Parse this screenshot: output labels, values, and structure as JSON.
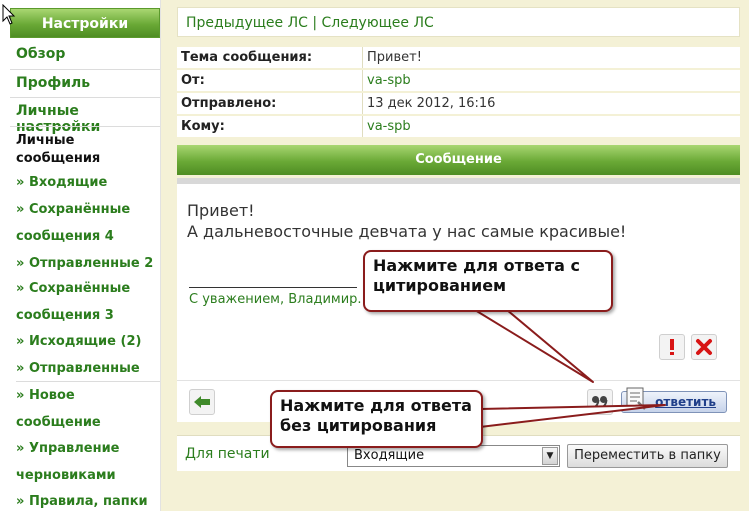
{
  "sidebar": {
    "title": "Настройки",
    "links": [
      "Обзор",
      "Профиль",
      "Личные настройки"
    ],
    "pm_section": "Личные сообщения",
    "pm_items": [
      {
        "bullet": "»",
        "label": "Входящие"
      },
      {
        "bullet": "»",
        "label": "Сохранённые сообщения 4"
      },
      {
        "bullet": "»",
        "label": "Отправленные 2"
      },
      {
        "bullet": "»",
        "label": "Сохранённые сообщения 3"
      },
      {
        "bullet": "»",
        "label": "Исходящие (2)"
      },
      {
        "bullet": "»",
        "label": "Отправленные"
      },
      {
        "bullet": "»",
        "label": "Новое сообщение"
      },
      {
        "bullet": "»",
        "label": "Управление черновиками"
      },
      {
        "bullet": "»",
        "label": "Правила, папки"
      }
    ]
  },
  "nav": {
    "prev": "Предыдущее ЛС",
    "separator": "|",
    "next": "Следующее ЛС"
  },
  "header": {
    "subject_label": "Тема сообщения:",
    "subject": "Привет!",
    "from_label": "От:",
    "from": "va-spb",
    "sent_label": "Отправлено:",
    "sent": "13 дек 2012, 16:16",
    "to_label": "Кому:",
    "to": "va-spb"
  },
  "message": {
    "bar_title": "Сообщение",
    "line1": "Привет!",
    "line2": "А дальневосточные девчата у нас самые красивые!",
    "signature": "С уважением, Владимир."
  },
  "actions": {
    "reply_label": "ответить"
  },
  "bottom": {
    "print_label": "Для печати",
    "folder_selected": "Входящие",
    "move_label": "Переместить в папку"
  },
  "callouts": {
    "quote": "Нажмите для ответа с цитированием",
    "reply": "Нажмите для ответа без цитирования"
  },
  "colors": {
    "accent_green": "#2b7d1d",
    "header_green": "#6aa936",
    "page_bg": "#f4f1d6",
    "callout_border": "#8a1c1c"
  },
  "icons": [
    "cursor-icon",
    "warning-icon",
    "delete-icon",
    "back-arrow-icon",
    "quote-icon",
    "reply-icon",
    "dropdown-arrow-icon"
  ]
}
